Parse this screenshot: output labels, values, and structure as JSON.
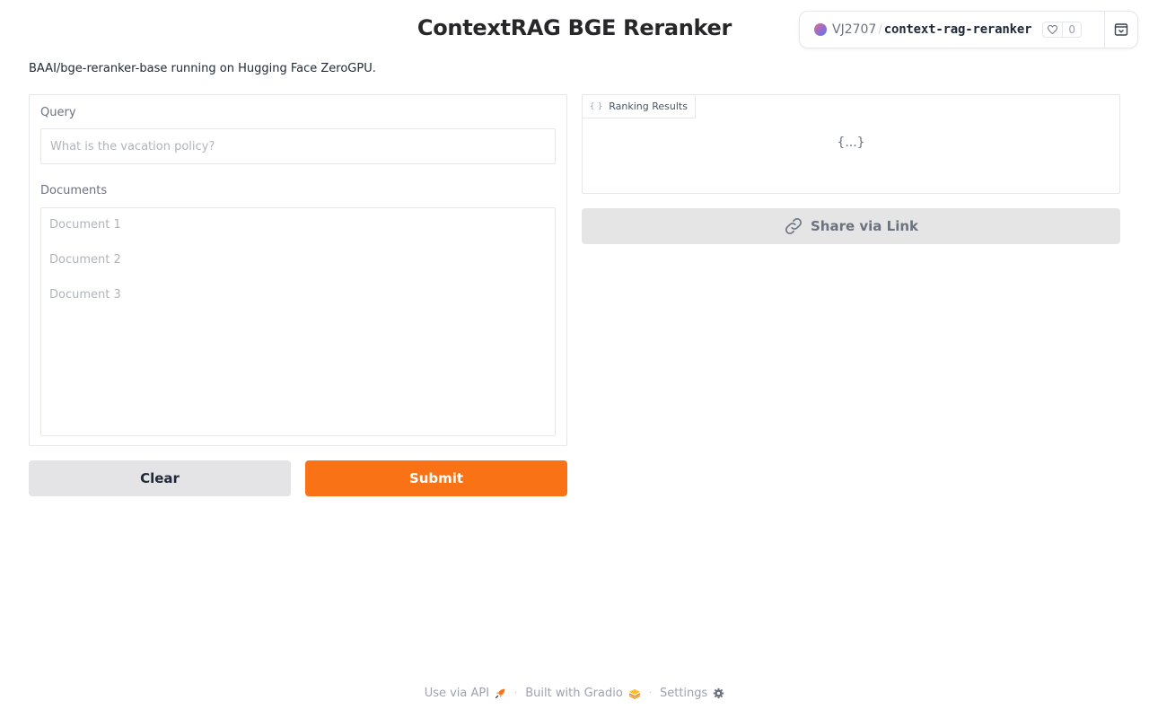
{
  "app": {
    "title": "ContextRAG BGE Reranker",
    "description": "BAAI/bge-reranker-base running on Hugging Face ZeroGPU."
  },
  "hf_badge": {
    "user": "VJ2707",
    "separator": "/",
    "repo": "context-rag-reranker",
    "likes": "0"
  },
  "form": {
    "query_label": "Query",
    "query_value": "",
    "query_placeholder": "What is the vacation policy?",
    "documents_label": "Documents",
    "documents_value": "",
    "documents_placeholder_lines": [
      "Document 1",
      "Document 2",
      "Document 3"
    ]
  },
  "buttons": {
    "clear": "Clear",
    "submit": "Submit",
    "share": "Share via Link"
  },
  "output": {
    "tab_label": "Ranking Results",
    "tab_icon": "{ }",
    "empty_value": "{...}"
  },
  "footer": {
    "api": "Use via API",
    "built": "Built with Gradio",
    "settings": "Settings",
    "separator": "·"
  },
  "colors": {
    "accent": "#f97316",
    "secondary_button": "#e4e4e7",
    "share_button": "#e5e5e5"
  }
}
